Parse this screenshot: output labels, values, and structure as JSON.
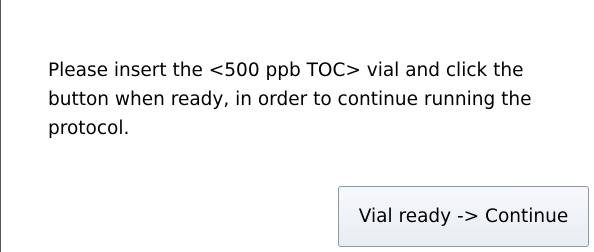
{
  "dialog": {
    "message": "Please insert the <500 ppb TOC> vial and click the button when ready, in order to continue running the protocol.",
    "button_label": "Vial ready -> Continue"
  }
}
